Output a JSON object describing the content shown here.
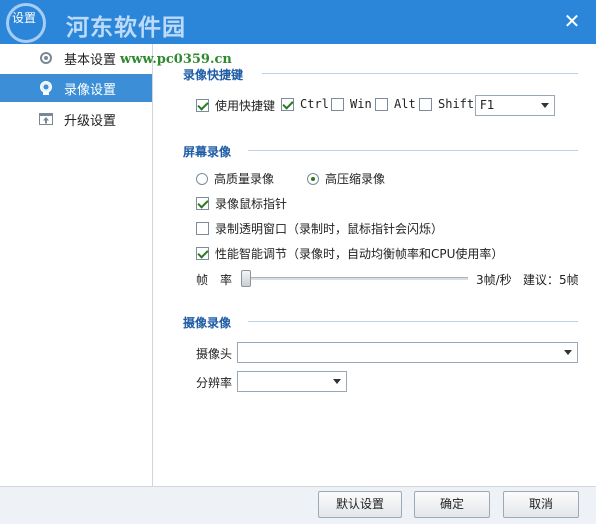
{
  "window": {
    "title": "设置",
    "watermark": "河东软件园",
    "watermark_url": "www.pc0359.cn"
  },
  "sidebar": {
    "items": [
      {
        "label": "基本设置",
        "icon": "gear-icon",
        "active": false
      },
      {
        "label": "录像设置",
        "icon": "camera-icon",
        "active": true
      },
      {
        "label": "升级设置",
        "icon": "upgrade-icon",
        "active": false
      }
    ]
  },
  "hotkey_section": {
    "title": "录像快捷键",
    "use_hotkey_label": "使用快捷键",
    "use_hotkey_checked": true,
    "ctrl_label": "Ctrl",
    "ctrl_checked": true,
    "win_label": "Win",
    "win_checked": false,
    "alt_label": "Alt",
    "alt_checked": false,
    "shift_label": "Shift",
    "shift_checked": false,
    "key_value": "F1"
  },
  "screen_section": {
    "title": "屏幕录像",
    "quality_high_label": "高质量录像",
    "quality_high_selected": false,
    "compress_high_label": "高压缩录像",
    "compress_high_selected": true,
    "record_pointer_label": "录像鼠标指针",
    "record_pointer_checked": true,
    "transparent_label": "录制透明窗口（录制时，鼠标指针会闪烁）",
    "transparent_checked": false,
    "smart_label": "性能智能调节（录像时，自动均衡帧率和CPU使用率）",
    "smart_checked": true,
    "framerate_label": "帧　率",
    "framerate_value": "3帧/秒",
    "framerate_suggest": "建议：5帧",
    "framerate_level": 0.0
  },
  "camera_section": {
    "title": "摄像录像",
    "camera_label": "摄像头",
    "camera_value": "",
    "resolution_label": "分辨率",
    "resolution_value": ""
  },
  "footer": {
    "default_label": "默认设置",
    "ok_label": "确定",
    "cancel_label": "取消"
  },
  "colors": {
    "titlebar": "#2b86d9",
    "active_nav": "#3c8fd6",
    "section_title": "#1f5da6"
  }
}
